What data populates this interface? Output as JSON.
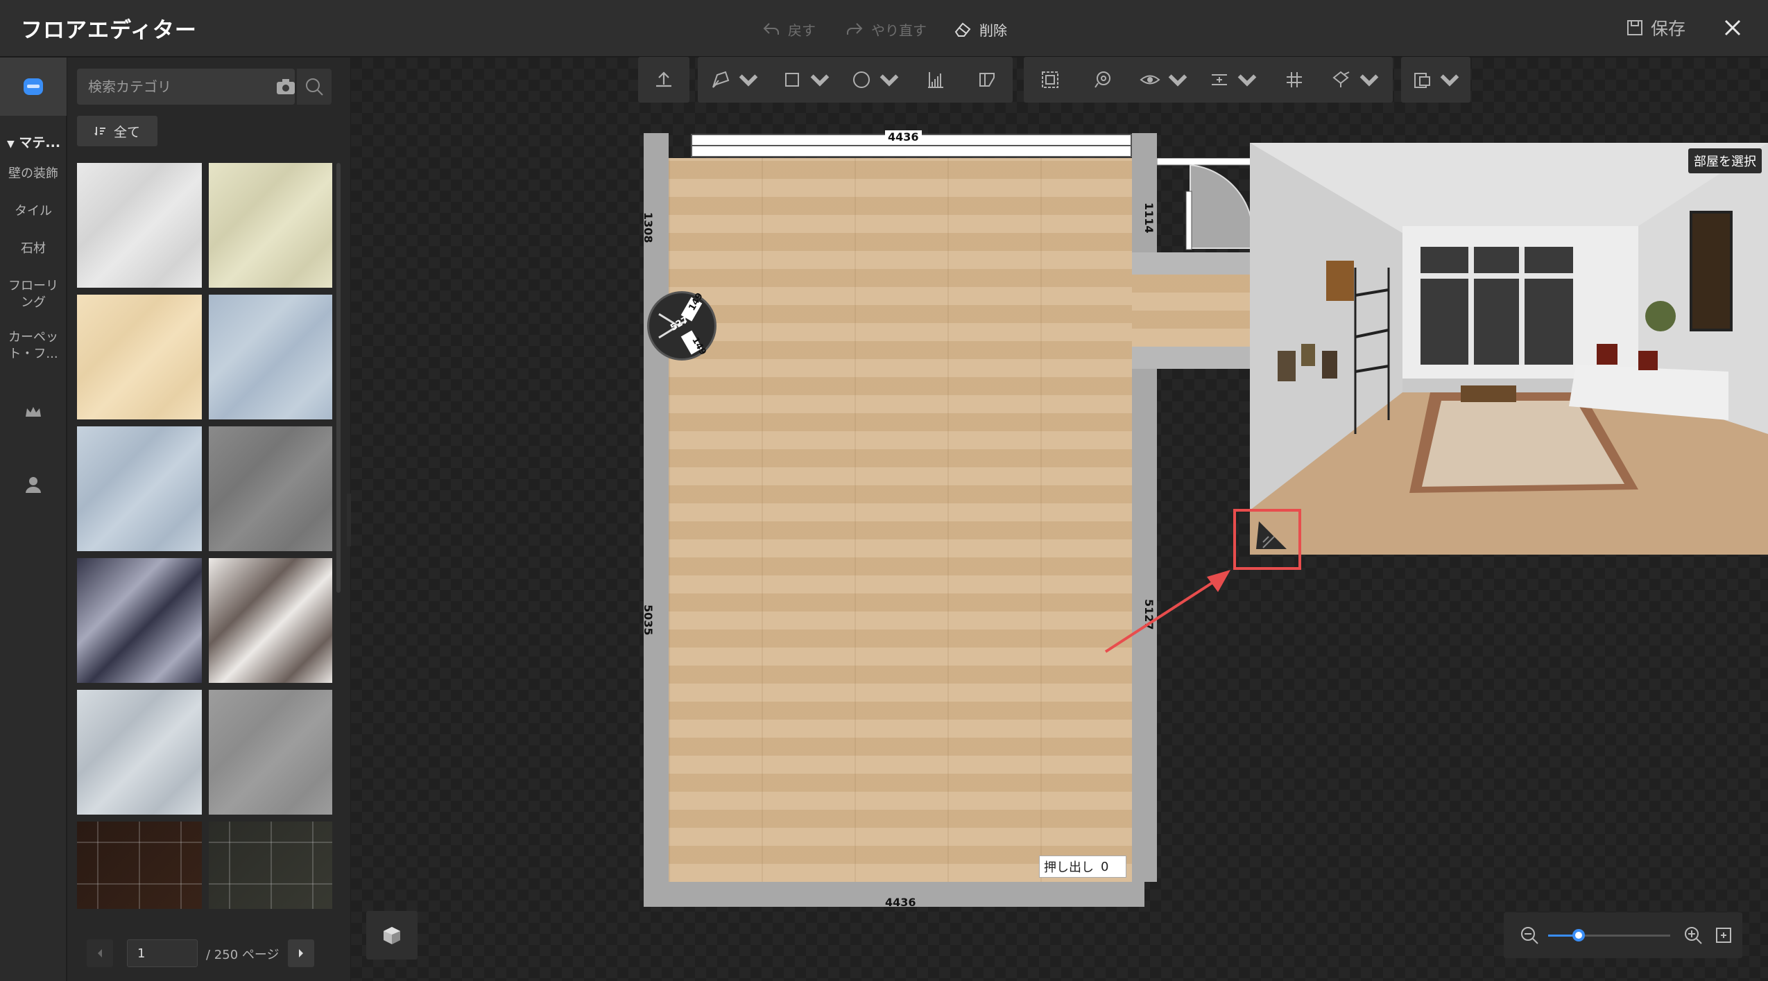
{
  "window": {
    "title": "フロアエディター",
    "undo_label": "戻す",
    "redo_label": "やり直す",
    "delete_label": "削除",
    "save_label": "保存"
  },
  "rail": {
    "section_label": "マテ...",
    "items": [
      {
        "label": "壁の装飾"
      },
      {
        "label": "タイル"
      },
      {
        "label": "石材"
      },
      {
        "label": "フローリング"
      },
      {
        "label": "カーペット・フ..."
      }
    ],
    "icons": [
      "material-icon",
      "crown-icon",
      "user-icon"
    ]
  },
  "panel": {
    "search_placeholder": "検索カテゴリ",
    "filter_label": "全て",
    "tiles": [
      {
        "name": "white-marble",
        "colors": [
          "#e9e9e9",
          "#d4d4d4"
        ]
      },
      {
        "name": "cream-marble",
        "colors": [
          "#e6e4c7",
          "#d2cfae"
        ]
      },
      {
        "name": "beige-tile",
        "colors": [
          "#f3e0bb",
          "#e8d1a6"
        ]
      },
      {
        "name": "blue-grey-marble",
        "colors": [
          "#a9b9cb",
          "#c3d0dc"
        ]
      },
      {
        "name": "ice-marble",
        "colors": [
          "#c6d2de",
          "#a9b8c8"
        ]
      },
      {
        "name": "grey-stone",
        "colors": [
          "#8a8a8a",
          "#767676"
        ]
      },
      {
        "name": "dark-granite",
        "colors": [
          "#35364a",
          "#a6a8bb"
        ]
      },
      {
        "name": "white-granite",
        "colors": [
          "#ece9e6",
          "#6b5f5a"
        ]
      },
      {
        "name": "silver-marble",
        "colors": [
          "#d5dbe0",
          "#b4bcc4"
        ]
      },
      {
        "name": "grey-concrete",
        "colors": [
          "#9d9d9d",
          "#8c8c8c"
        ]
      },
      {
        "name": "dark-wood-tile",
        "colors": [
          "#2a1a13",
          "#3a2419"
        ]
      },
      {
        "name": "dark-slate-tile",
        "colors": [
          "#2b2c27",
          "#3a3b33"
        ]
      }
    ],
    "pager": {
      "current": "1",
      "total_label": "/ 250 ページ"
    }
  },
  "plan": {
    "dims": {
      "top": "4436",
      "bottom": "4436",
      "left_upper": "1308",
      "left_lower": "5035",
      "right_door": "1114",
      "right_lower": "5127"
    },
    "column_labels": {
      "a": "149",
      "b": "149",
      "center": "527"
    },
    "extrude_label": "押し出し",
    "extrude_value": "0"
  },
  "preview": {
    "select_room_label": "部屋を選択"
  },
  "zoom": {
    "level": 0.25
  },
  "colors": {
    "accent": "#3a8ef6",
    "highlight": "#e84d4d",
    "floor": "#d6b78f",
    "wall": "#a8a8a8"
  }
}
